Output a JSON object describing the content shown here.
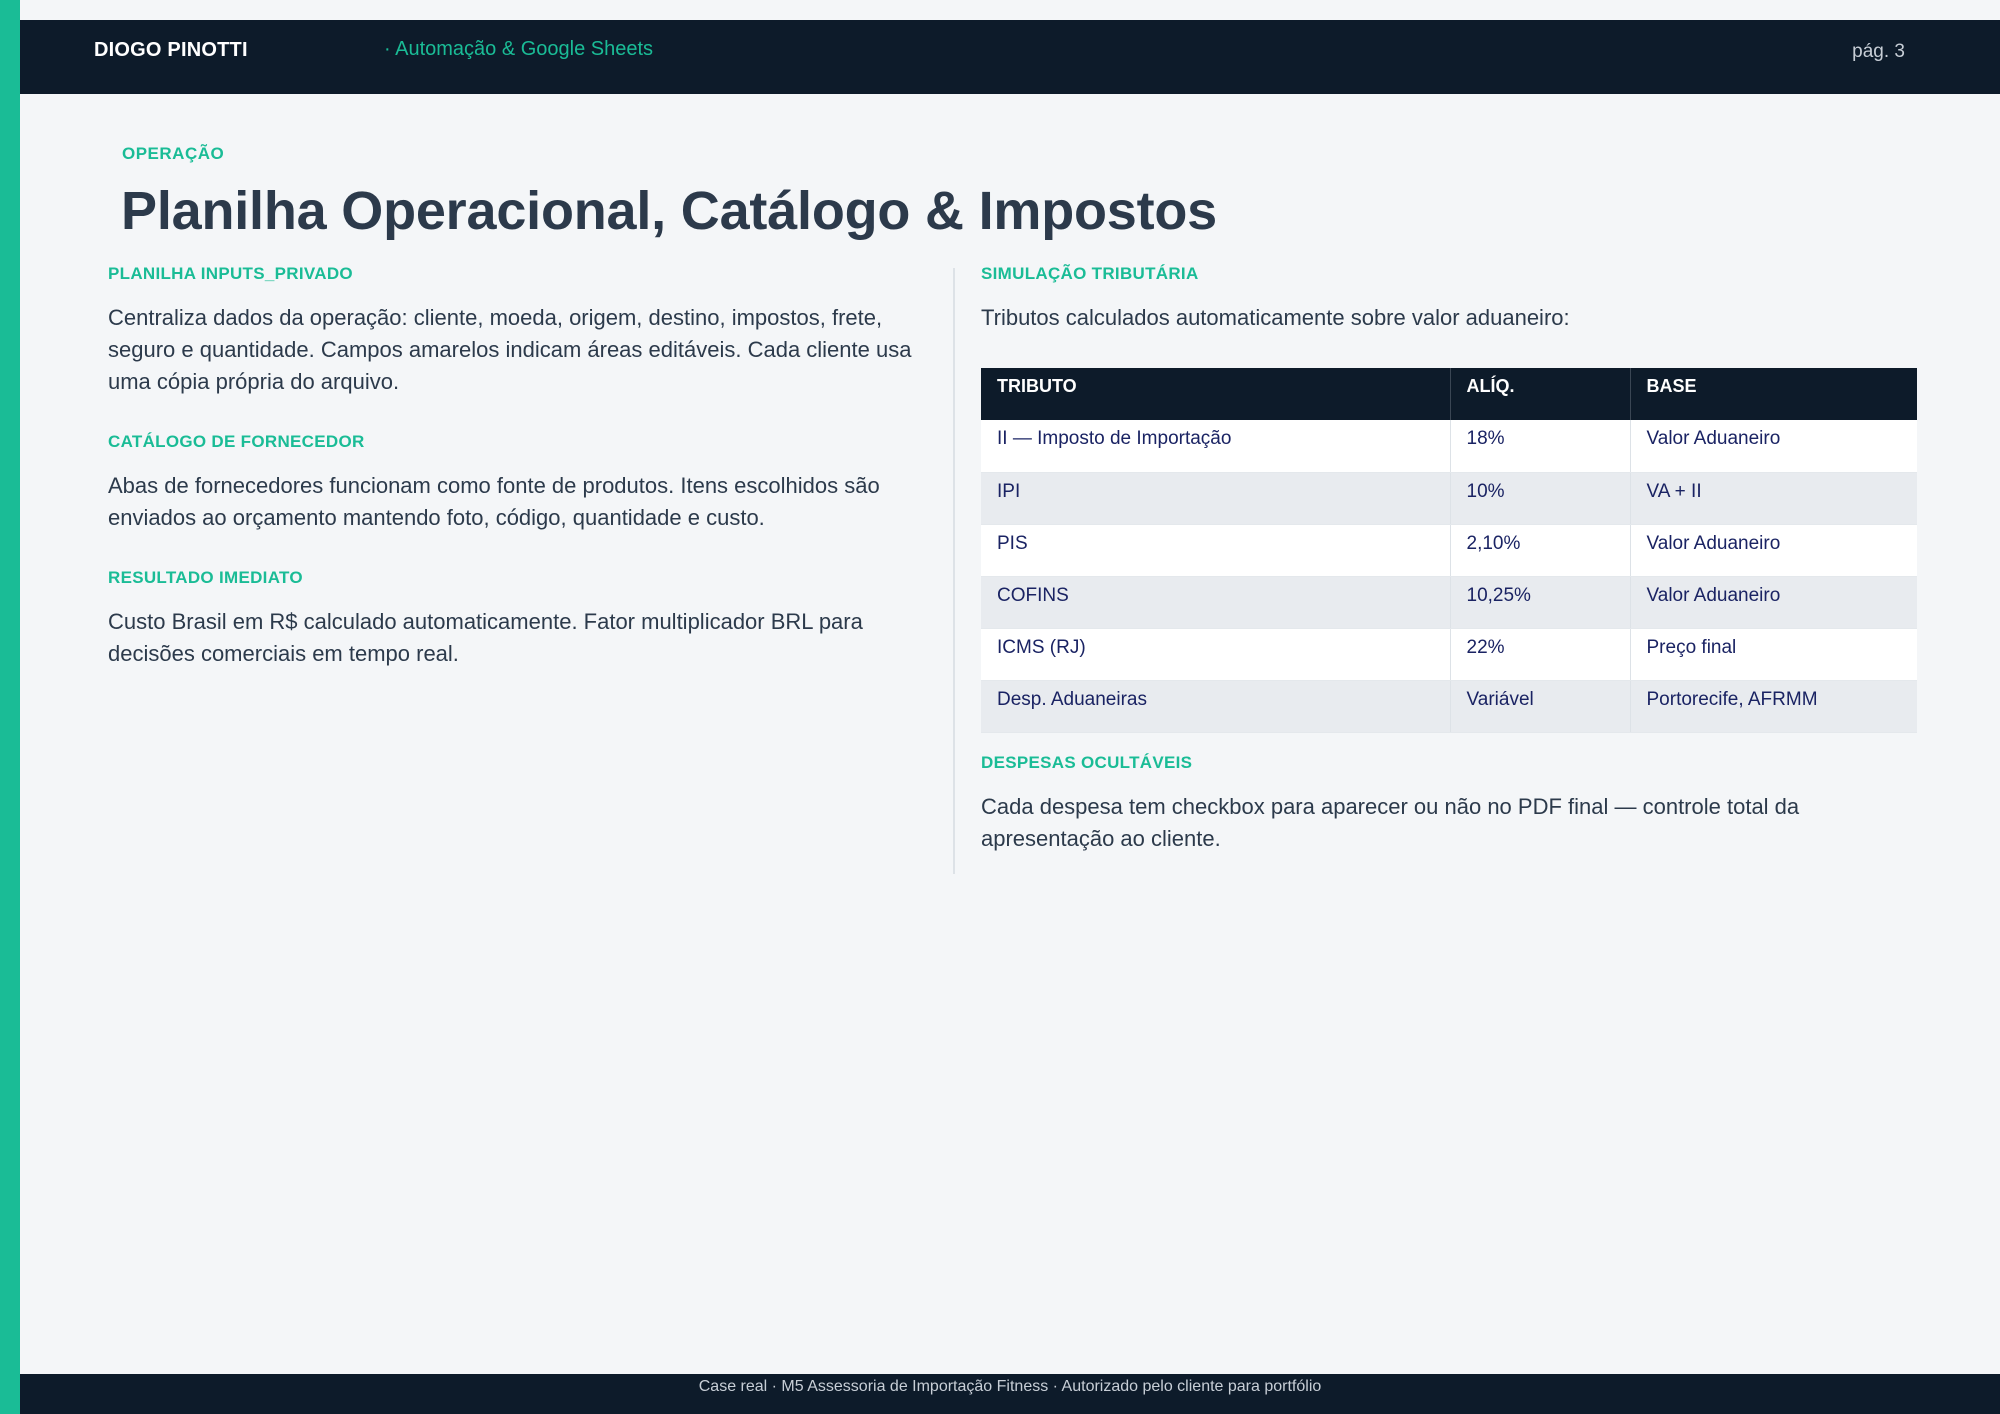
{
  "header": {
    "brand": "DIOGO PINOTTI",
    "tagline": "· Automação & Google Sheets",
    "page_number": "pág. 3"
  },
  "eyebrow": "OPERAÇÃO",
  "title": "Planilha Operacional, Catálogo & Impostos",
  "left_sections": [
    {
      "title": "PLANILHA INPUTS_PRIVADO",
      "text": "Centraliza dados da operação: cliente, moeda, origem, destino, impostos, frete, seguro e quantidade. Campos amarelos indicam áreas editáveis. Cada cliente usa uma cópia própria do arquivo."
    },
    {
      "title": "CATÁLOGO DE FORNECEDOR",
      "text": "Abas de fornecedores funcionam como fonte de produtos. Itens escolhidos são enviados ao orçamento mantendo foto, código, quantidade e custo."
    },
    {
      "title": "RESULTADO IMEDIATO",
      "text": "Custo Brasil em R$ calculado automaticamente. Fator multiplicador BRL para decisões comerciais em tempo real."
    }
  ],
  "simulation": {
    "title": "SIMULAÇÃO TRIBUTÁRIA",
    "text": "Tributos calculados automaticamente sobre valor aduaneiro:",
    "table": {
      "headers": [
        "TRIBUTO",
        "ALÍQ.",
        "BASE"
      ],
      "rows": [
        [
          "II — Imposto de Importação",
          "18%",
          "Valor Aduaneiro"
        ],
        [
          "IPI",
          "10%",
          "VA + II"
        ],
        [
          "PIS",
          "2,10%",
          "Valor Aduaneiro"
        ],
        [
          "COFINS",
          "10,25%",
          "Valor Aduaneiro"
        ],
        [
          "ICMS (RJ)",
          "22%",
          "Preço final"
        ],
        [
          "Desp. Aduaneiras",
          "Variável",
          "Portorecife, AFRMM"
        ]
      ]
    }
  },
  "hidden_expenses": {
    "title": "DESPESAS OCULTÁVEIS",
    "text": "Cada despesa tem checkbox para aparecer ou não no PDF final — controle total da apresentação ao cliente."
  },
  "footer": {
    "text": "Case real · M5 Assessoria de Importação Fitness · Autorizado pelo cliente para portfólio"
  },
  "colors": {
    "accent": "#1abc96",
    "dark": "#0d1b2a",
    "text": "#2c3a4b",
    "table_text": "#1a2363"
  }
}
